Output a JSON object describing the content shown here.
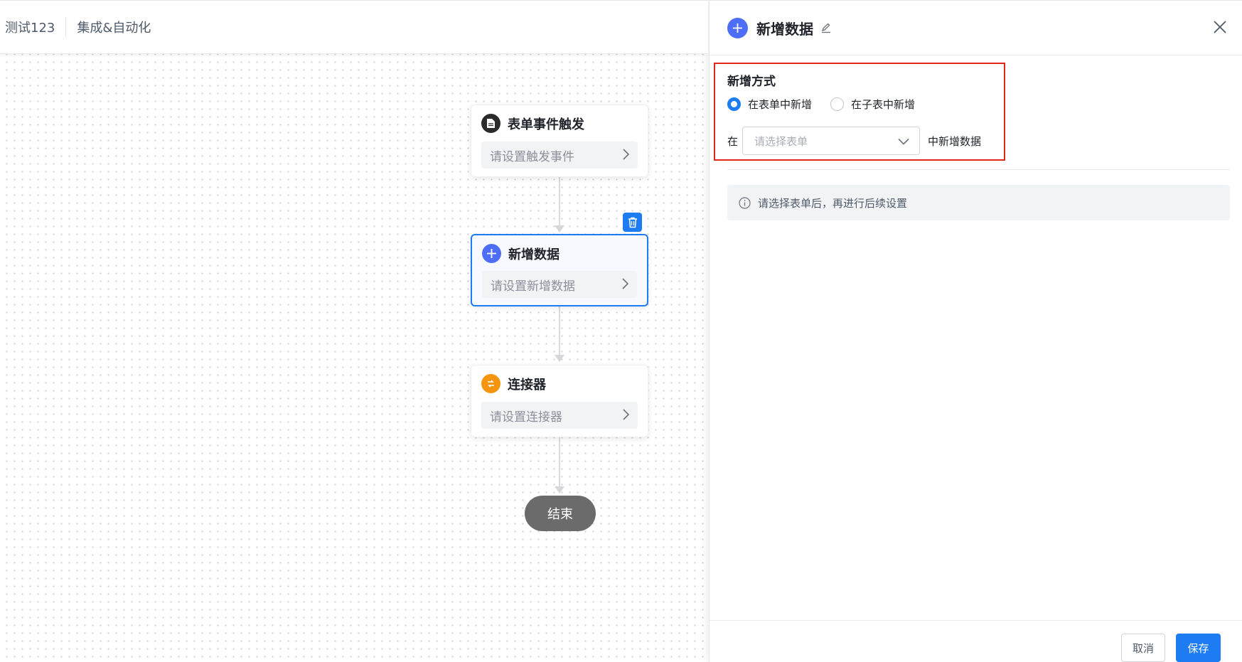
{
  "header": {
    "app_name": "测试123",
    "section_name": "集成&自动化"
  },
  "flow": {
    "nodes": [
      {
        "title": "表单事件触发",
        "placeholder": "请设置触发事件",
        "icon": "document-icon",
        "color": "#2b2b2b"
      },
      {
        "title": "新增数据",
        "placeholder": "请设置新增数据",
        "icon": "plus-icon",
        "color": "#4f6ef7"
      },
      {
        "title": "连接器",
        "placeholder": "请设置连接器",
        "icon": "connector-icon",
        "color": "#f5950e"
      }
    ],
    "end_label": "结束"
  },
  "drawer": {
    "title": "新增数据",
    "section_title": "新增方式",
    "radio_options": [
      "在表单中新增",
      "在子表中新增"
    ],
    "selected_option": "在表单中新增",
    "select_prefix": "在",
    "select_placeholder": "请选择表单",
    "select_suffix": "中新增数据",
    "info_text": "请选择表单后，再进行后续设置",
    "cancel_label": "取消",
    "save_label": "保存"
  },
  "colors": {
    "primary": "#1e7cf2",
    "highlight_border": "#e1261c",
    "end_pill": "#6b6b6b"
  }
}
